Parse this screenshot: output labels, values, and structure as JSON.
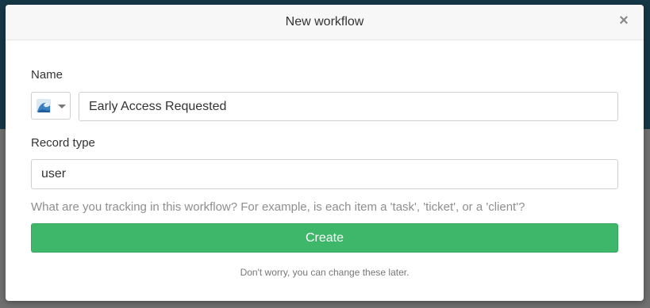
{
  "modal": {
    "title": "New workflow",
    "close_glyph": "×"
  },
  "form": {
    "name_label": "Name",
    "emoji_icon": "wave-emoji-icon",
    "name_value": "Early Access Requested",
    "record_type_label": "Record type",
    "record_type_value": "user",
    "record_type_help": "What are you tracking in this workflow? For example, is each item a 'task', 'ticket', or a 'client'?",
    "create_label": "Create",
    "footnote": "Don't worry, you can change these later."
  },
  "colors": {
    "primary_button": "#3fb76a",
    "backdrop_top": "#163746",
    "backdrop_bottom": "#707070"
  }
}
